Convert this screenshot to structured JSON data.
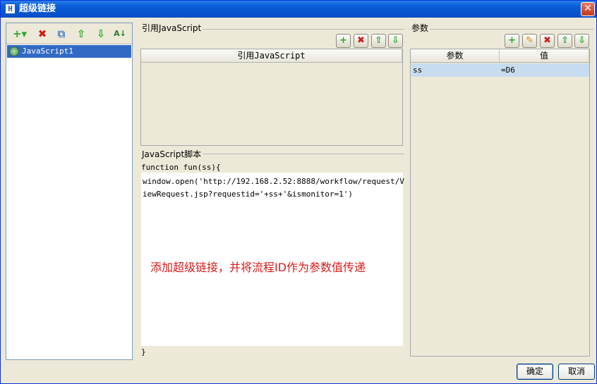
{
  "window": {
    "title": "超级链接",
    "app_icon": "H",
    "close_glyph": "✕"
  },
  "left_toolbar": {
    "add_icon": "+▾",
    "delete_icon": "✖",
    "copy_icon": "⧉",
    "up_icon": "⇧",
    "down_icon": "⇩",
    "sort_icon": "A↓"
  },
  "tree": {
    "items": [
      {
        "label": "JavaScript1",
        "selected": true
      }
    ]
  },
  "js_ref": {
    "group_title": "引用JavaScript",
    "column_header": "引用JavaScript",
    "rows": []
  },
  "script": {
    "group_title": "JavaScript脚本",
    "line_open": "function fun(ss){",
    "body_line1": "window.open('http://192.168.2.52:8888/workflow/request/V",
    "body_line2": "iewRequest.jsp?requestid='+ss+'&ismonitor=1')",
    "line_close": "}"
  },
  "annotation": {
    "text": "添加超级链接，并将流程ID作为参数值传递",
    "color": "#d61b1b"
  },
  "params": {
    "group_title": "参数",
    "columns": [
      "参数",
      "值"
    ],
    "rows": [
      {
        "name": "ss",
        "value": "=D6"
      }
    ]
  },
  "buttons": {
    "ok": "确定",
    "cancel": "取消"
  },
  "colors": {
    "selection": "#316ac5",
    "title_bar": "#0a5fd8",
    "row_highlight": "#c8dcef"
  }
}
